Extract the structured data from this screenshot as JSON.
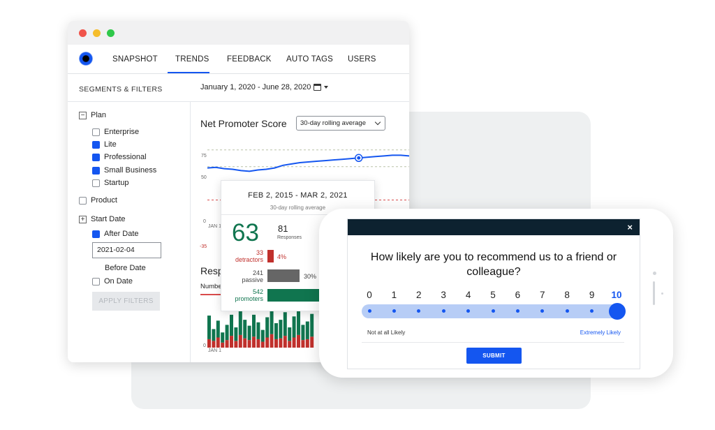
{
  "nav": {
    "tabs": [
      {
        "label": "SNAPSHOT"
      },
      {
        "label": "TRENDS",
        "active": true
      },
      {
        "label": "FEEDBACK"
      },
      {
        "label": "AUTO TAGS"
      },
      {
        "label": "USERS"
      }
    ]
  },
  "sidebar": {
    "title": "SEGMENTS & FILTERS",
    "plan_label": "Plan",
    "plan_options": [
      {
        "label": "Enterprise",
        "checked": false
      },
      {
        "label": "Lite",
        "checked": true
      },
      {
        "label": "Professional",
        "checked": true
      },
      {
        "label": "Small Business",
        "checked": true
      },
      {
        "label": "Startup",
        "checked": false
      }
    ],
    "product_label": "Product",
    "start_date_label": "Start Date",
    "after_date_label": "After Date",
    "after_date_value": "2021-02-04",
    "before_date_label": "Before Date",
    "on_date_label": "On Date",
    "apply_label": "APPLY FILTERS"
  },
  "toolbar": {
    "date_range": "January 1, 2020 - June 28, 2020"
  },
  "nps": {
    "title": "Net Promoter Score",
    "select_value": "30-day rolling average",
    "axis_labels": [
      "75",
      "50",
      "0",
      "-35"
    ],
    "x_start_label": "JAN 1",
    "line": [
      48,
      49,
      47,
      46,
      44,
      43,
      45,
      46,
      48,
      52,
      54,
      56,
      57,
      58,
      59,
      60,
      61,
      62,
      63,
      64,
      65,
      66,
      67,
      67,
      66
    ]
  },
  "responses": {
    "title": "Resp",
    "tab_label": "Number",
    "axis_zero": "0",
    "x_start_label": "JAN 1",
    "green": [
      28,
      14,
      20,
      12,
      18,
      25,
      16,
      30,
      22,
      17,
      26,
      20,
      14,
      24,
      31,
      19,
      22,
      28,
      16,
      25,
      30,
      18,
      21,
      27
    ],
    "red": [
      10,
      8,
      12,
      6,
      9,
      14,
      8,
      15,
      11,
      9,
      13,
      10,
      7,
      12,
      16,
      10,
      11,
      14,
      8,
      12,
      15,
      9,
      10,
      13
    ]
  },
  "tooltip": {
    "date_range": "FEB 2, 2015 - MAR 2, 2021",
    "subtitle": "30-day rolling average",
    "score": "63",
    "responses_count": "81",
    "responses_label": "Responses",
    "detractors_count": "33",
    "detractors_label": "detractors",
    "detractors_pct": "4%",
    "detractors_fraction": 0.04,
    "passive_count": "241",
    "passive_label": "passive",
    "passive_pct": "30%",
    "passive_fraction": 0.3,
    "promoters_count": "542",
    "promoters_label": "promoters",
    "colors": {
      "detractor": "#c0302c",
      "passive": "#666666",
      "promoter": "#10754f"
    }
  },
  "survey": {
    "question": "How likely are you to recommend us to a friend or colleague?",
    "close_glyph": "×",
    "scale": [
      "0",
      "1",
      "2",
      "3",
      "4",
      "5",
      "6",
      "7",
      "8",
      "9",
      "10"
    ],
    "selected": "10",
    "low_hint": "Not at all Likely",
    "high_hint": "Extremely Likely",
    "submit_label": "SUBMIT"
  },
  "colors": {
    "accent": "#1456f0",
    "survey_header": "#0d2230",
    "promoter": "#10754f",
    "detractor": "#c0302c"
  }
}
